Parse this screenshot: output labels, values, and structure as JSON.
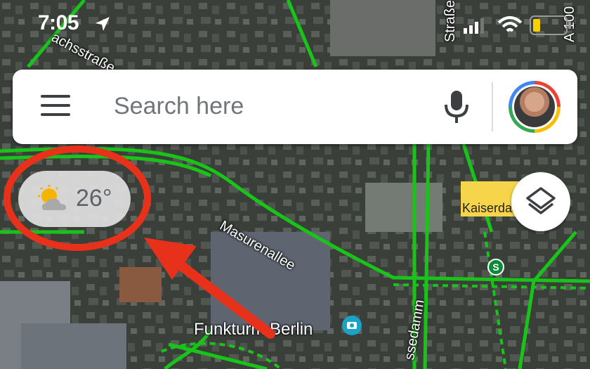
{
  "status": {
    "time": "7:05"
  },
  "search": {
    "placeholder": "Search here"
  },
  "weather": {
    "temperature": "26°",
    "icon": "partly-sunny-icon"
  },
  "map": {
    "streets": [
      "Masurenallee",
      "Straße",
      "A 100",
      "achsstraße",
      "ssedamm"
    ],
    "places": [
      "Funkturm Berlin",
      "Kaiserdamm"
    ],
    "station_badge": "S"
  },
  "colors": {
    "traffic": "#19c419",
    "highlight": "#e8311a",
    "accent": "#4285f4"
  }
}
